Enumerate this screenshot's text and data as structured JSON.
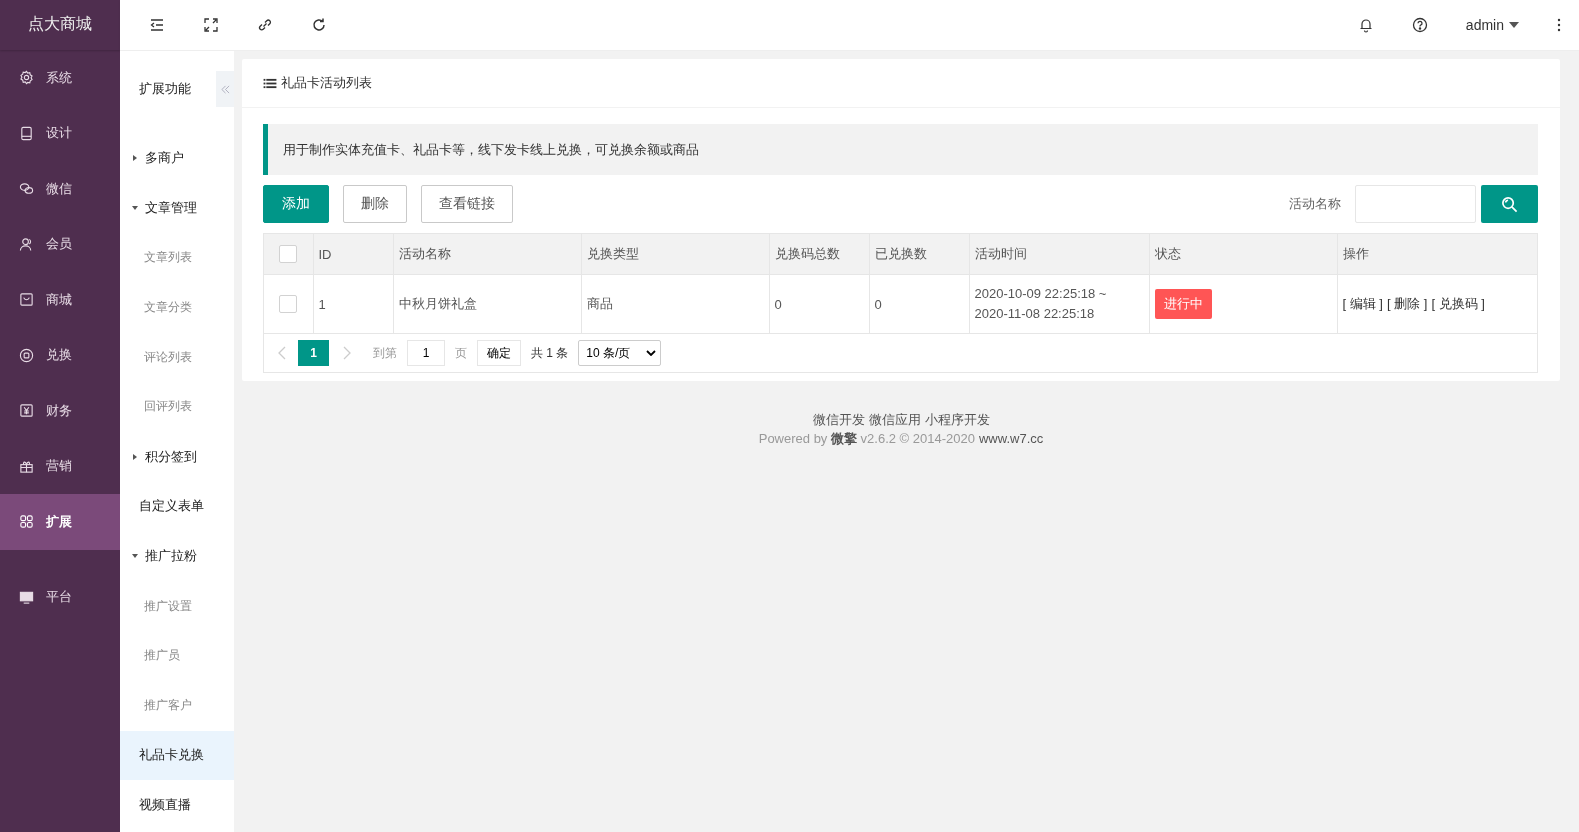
{
  "brand": "点大商城",
  "nav": [
    {
      "label": "系统",
      "selected": false
    },
    {
      "label": "设计",
      "selected": false
    },
    {
      "label": "微信",
      "selected": false
    },
    {
      "label": "会员",
      "selected": false
    },
    {
      "label": "商城",
      "selected": false
    },
    {
      "label": "兑换",
      "selected": false
    },
    {
      "label": "财务",
      "selected": false
    },
    {
      "label": "营销",
      "selected": false
    },
    {
      "label": "扩展",
      "selected": true
    },
    {
      "label": "平台",
      "selected": false
    }
  ],
  "topbar": {
    "user": "admin"
  },
  "subnav": {
    "title": "扩展功能",
    "items": [
      {
        "kind": "group",
        "label": "多商户",
        "expanded": false
      },
      {
        "kind": "group",
        "label": "文章管理",
        "expanded": true,
        "children": [
          {
            "label": "文章列表",
            "selected": false
          },
          {
            "label": "文章分类",
            "selected": false
          },
          {
            "label": "评论列表",
            "selected": false
          },
          {
            "label": "回评列表",
            "selected": false
          }
        ]
      },
      {
        "kind": "group",
        "label": "积分签到",
        "expanded": false
      },
      {
        "kind": "link",
        "label": "自定义表单",
        "selected": false
      },
      {
        "kind": "group",
        "label": "推广拉粉",
        "expanded": true,
        "children": [
          {
            "label": "推广设置",
            "selected": false
          },
          {
            "label": "推广员",
            "selected": false
          },
          {
            "label": "推广客户",
            "selected": false
          }
        ]
      },
      {
        "kind": "link",
        "label": "礼品卡兑换",
        "selected": true
      },
      {
        "kind": "link",
        "label": "视频直播",
        "selected": false
      }
    ]
  },
  "panel": {
    "title": "礼品卡活动列表",
    "notice": "用于制作实体充值卡、礼品卡等，线下发卡线上兑换，可兑换余额或商品",
    "buttons": [
      "添加",
      "删除",
      "查看链接"
    ],
    "search": {
      "label": "活动名称"
    }
  },
  "table": {
    "all_checked": false,
    "columns": [
      "ID",
      "活动名称",
      "兑换类型",
      "兑换码总数",
      "已兑换数",
      "活动时间",
      "状态",
      "操作"
    ],
    "rows": [
      {
        "checked": false,
        "id": "1",
        "name": "中秋月饼礼盒",
        "type": "商品",
        "total": "0",
        "used": "0",
        "start": "2020-10-09 22:25:18 ~",
        "end": "2020-11-08 22:25:18",
        "status": "进行中",
        "actions": [
          "[ 编辑 ]",
          "[ 删除 ]",
          "[ 兑换码 ]"
        ]
      }
    ]
  },
  "pager": {
    "pages": [
      {
        "label": "1",
        "selected": true
      }
    ],
    "goto": "到第",
    "page_value": "1",
    "page_unit": "页",
    "confirm": "确定",
    "total": "共 1 条",
    "page_size": "10 条/页"
  },
  "footer": {
    "links": [
      "微信开发",
      "微信应用",
      "小程序开发"
    ],
    "powered": "Powered by **微擎** v2.6.2 © 2014-2020",
    "site": "www.w7.cc"
  }
}
